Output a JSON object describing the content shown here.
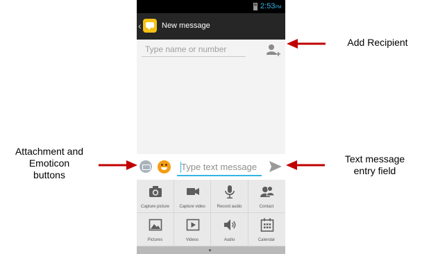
{
  "status_bar": {
    "time": "2:53",
    "meridiem": "PM"
  },
  "action_bar": {
    "title": "New message"
  },
  "recipient": {
    "placeholder": "Type name or number"
  },
  "compose": {
    "placeholder": "Type text message"
  },
  "attachments": [
    {
      "label": "Capture picture",
      "icon": "camera-icon"
    },
    {
      "label": "Capture video",
      "icon": "video-camera-icon"
    },
    {
      "label": "Record audio",
      "icon": "microphone-icon"
    },
    {
      "label": "Contact",
      "icon": "contact-icon"
    },
    {
      "label": "Pictures",
      "icon": "picture-icon"
    },
    {
      "label": "Videos",
      "icon": "video-play-icon"
    },
    {
      "label": "Audio",
      "icon": "speaker-icon"
    },
    {
      "label": "Calendar",
      "icon": "calendar-icon"
    }
  ],
  "callouts": {
    "add_recipient": "Add Recipient",
    "attachment_line1": "Attachment and",
    "attachment_line2": "Emoticon",
    "attachment_line3": "buttons",
    "text_entry_line1": "Text message",
    "text_entry_line2": "entry field"
  },
  "colors": {
    "accent": "#33b5e5",
    "arrow": "#c00000",
    "action_bar": "#262626",
    "emoticon": "#f39d15"
  }
}
